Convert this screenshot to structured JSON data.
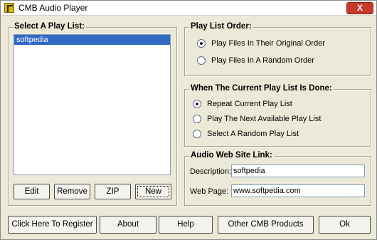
{
  "window": {
    "title": "CMB Audio Player",
    "close_label": "X"
  },
  "playlist": {
    "title": "Select A Play List:",
    "items": [
      "softpedia"
    ],
    "buttons": {
      "edit": "Edit",
      "remove": "Remove",
      "zip": "ZIP",
      "new": "New"
    }
  },
  "order": {
    "title": "Play List Order:",
    "options": [
      "Play Files In Their Original Order",
      "Play Files In A Random Order"
    ],
    "selected": 0
  },
  "done": {
    "title": "When The Current Play List Is Done:",
    "options": [
      "Repeat Current Play List",
      "Play The Next Available Play List",
      "Select A Random Play List"
    ],
    "selected": 0
  },
  "website": {
    "title": "Audio Web Site Link:",
    "description_label": "Description:",
    "description_value": "softpedia",
    "webpage_label": "Web Page:",
    "webpage_value": "www.softpedia.com"
  },
  "bottom_buttons": {
    "register": "Click Here To Register",
    "about": "About",
    "help": "Help",
    "products": "Other CMB Products",
    "ok": "Ok"
  }
}
